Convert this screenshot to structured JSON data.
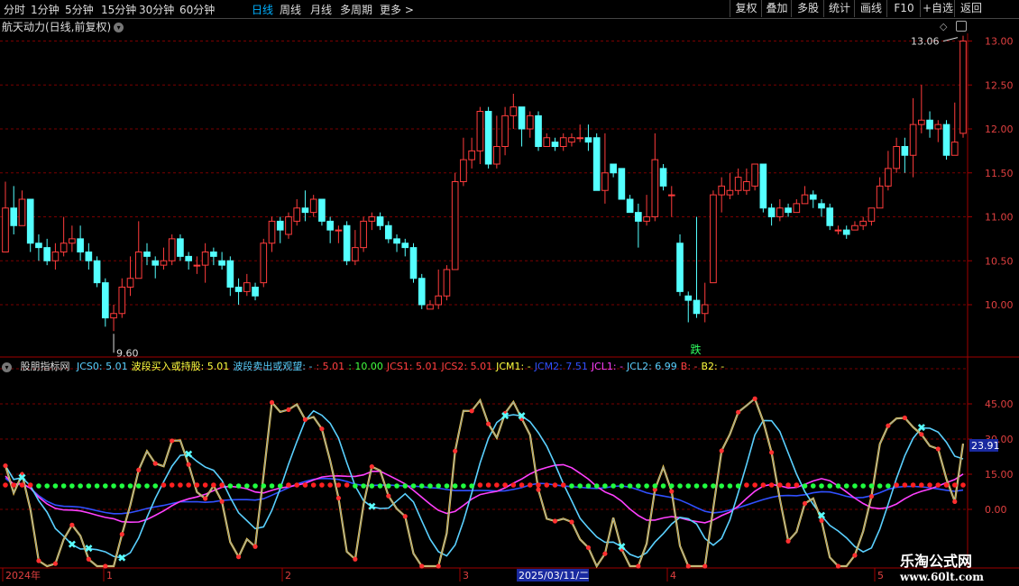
{
  "toolbar": {
    "periods": [
      "分时",
      "1分钟",
      "5分钟",
      "15分钟",
      "30分钟",
      "60分钟",
      "日线",
      "周线",
      "月线",
      "多周期",
      "更多 >"
    ],
    "active_period": "日线",
    "right": [
      "复权",
      "叠加",
      "多股",
      "统计",
      "画线",
      "F10",
      "+自选",
      "返回"
    ]
  },
  "main": {
    "title": "航天动力(日线,前复权)",
    "price_ticks": [
      "13.00",
      "12.50",
      "12.00",
      "11.50",
      "11.00",
      "10.50",
      "10.00"
    ],
    "high_label": "13.06",
    "low_label": "9.60",
    "signal": "跌"
  },
  "indicator": {
    "name": "股朋指标网",
    "legend": [
      {
        "text": "JCS0: 5.01",
        "color": "#5ad0ff"
      },
      {
        "text": "波段买入或持股: 5.01",
        "color": "#ffff40"
      },
      {
        "text": "波段卖出或观望: -",
        "color": "#5ad0ff"
      },
      {
        "text": ": 5.01",
        "color": "#ff4040"
      },
      {
        "text": ": 10.00",
        "color": "#40ff40"
      },
      {
        "text": "JCS1: 5.01",
        "color": "#ff4040"
      },
      {
        "text": "JCS2: 5.01",
        "color": "#ff4040"
      },
      {
        "text": "JCM1: -",
        "color": "#ffff40"
      },
      {
        "text": "JCM2: 7.51",
        "color": "#3050ff"
      },
      {
        "text": "JCL1: -",
        "color": "#ff40ff"
      },
      {
        "text": "JCL2: 6.99",
        "color": "#5ad0ff"
      },
      {
        "text": "B: -",
        "color": "#ff4040"
      },
      {
        "text": "B2: -",
        "color": "#ffff40"
      }
    ],
    "ticks": [
      "45.00",
      "30.00",
      "15.00",
      "0.00"
    ],
    "current_value": "23.91"
  },
  "timeline": {
    "labels": [
      "2024年",
      "1",
      "2",
      "3",
      "4",
      "5"
    ],
    "cursor_date": "2025/03/11/二"
  },
  "colors": {
    "up": "#ff3c3c",
    "down": "#54ffff",
    "grid": "#7a0000",
    "axis": "#a00000"
  },
  "watermark": {
    "line1": "乐淘公式网",
    "line2": "www.60lt.com"
  },
  "chart_data": {
    "type": "candlestick",
    "y_range": [
      9.5,
      13.3
    ],
    "candles": [
      [
        10.6,
        11.1,
        11.4,
        10.6
      ],
      [
        11.1,
        10.9,
        11.35,
        10.8
      ],
      [
        10.9,
        11.2,
        11.3,
        10.9
      ],
      [
        11.2,
        10.7,
        11.2,
        10.6
      ],
      [
        10.7,
        10.65,
        10.8,
        10.5
      ],
      [
        10.65,
        10.5,
        10.75,
        10.45
      ],
      [
        10.5,
        10.6,
        10.7,
        10.4
      ],
      [
        10.6,
        10.7,
        11.0,
        10.55
      ],
      [
        10.7,
        10.75,
        10.9,
        10.6
      ],
      [
        10.75,
        10.6,
        10.9,
        10.5
      ],
      [
        10.6,
        10.5,
        10.7,
        10.4
      ],
      [
        10.5,
        10.25,
        10.55,
        10.2
      ],
      [
        10.25,
        9.85,
        10.3,
        9.75
      ],
      [
        9.85,
        9.9,
        10.0,
        9.7
      ],
      [
        9.9,
        10.2,
        10.3,
        9.85
      ],
      [
        10.2,
        10.3,
        10.55,
        10.1
      ],
      [
        10.3,
        10.6,
        10.95,
        10.3
      ],
      [
        10.6,
        10.55,
        10.7,
        10.45
      ],
      [
        10.5,
        10.45,
        10.55,
        10.3
      ],
      [
        10.45,
        10.5,
        10.65,
        10.4
      ],
      [
        10.5,
        10.75,
        10.8,
        10.45
      ],
      [
        10.75,
        10.55,
        10.8,
        10.5
      ],
      [
        10.55,
        10.5,
        10.6,
        10.4
      ],
      [
        10.45,
        10.45,
        10.55,
        10.35
      ],
      [
        10.45,
        10.6,
        10.7,
        10.25
      ],
      [
        10.6,
        10.55,
        10.65,
        10.45
      ],
      [
        10.5,
        10.45,
        10.6,
        10.4
      ],
      [
        10.5,
        10.2,
        10.55,
        10.1
      ],
      [
        10.2,
        10.15,
        10.3,
        10.0
      ],
      [
        10.15,
        10.25,
        10.35,
        10.1
      ],
      [
        10.2,
        10.1,
        10.25,
        10.05
      ],
      [
        10.25,
        10.7,
        10.75,
        10.2
      ],
      [
        10.7,
        10.95,
        11.0,
        10.6
      ],
      [
        10.95,
        10.85,
        11.0,
        10.7
      ],
      [
        10.8,
        11.0,
        11.05,
        10.75
      ],
      [
        10.95,
        11.1,
        11.2,
        10.9
      ],
      [
        11.1,
        11.05,
        11.3,
        10.95
      ],
      [
        11.05,
        11.2,
        11.25,
        11.0
      ],
      [
        11.2,
        10.95,
        11.2,
        10.9
      ],
      [
        10.95,
        10.85,
        11.0,
        10.7
      ],
      [
        10.85,
        10.85,
        10.9,
        10.7
      ],
      [
        10.9,
        10.5,
        10.95,
        10.45
      ],
      [
        10.5,
        10.65,
        10.85,
        10.45
      ],
      [
        10.65,
        10.95,
        11.0,
        10.6
      ],
      [
        10.95,
        11.0,
        11.05,
        10.85
      ],
      [
        11.0,
        10.9,
        11.05,
        10.85
      ],
      [
        10.9,
        10.75,
        10.95,
        10.7
      ],
      [
        10.75,
        10.7,
        10.8,
        10.6
      ],
      [
        10.7,
        10.65,
        10.75,
        10.55
      ],
      [
        10.65,
        10.3,
        10.7,
        10.25
      ],
      [
        10.3,
        10.0,
        10.35,
        9.95
      ],
      [
        9.95,
        10.0,
        10.05,
        9.95
      ],
      [
        10.0,
        10.1,
        10.4,
        9.95
      ],
      [
        10.1,
        10.4,
        10.45,
        10.05
      ],
      [
        10.4,
        11.4,
        11.5,
        10.4
      ],
      [
        11.4,
        11.65,
        11.9,
        11.35
      ],
      [
        11.65,
        11.75,
        11.9,
        11.55
      ],
      [
        11.75,
        12.2,
        12.25,
        11.6
      ],
      [
        12.2,
        11.6,
        12.25,
        11.55
      ],
      [
        11.6,
        11.8,
        12.15,
        11.55
      ],
      [
        11.8,
        12.15,
        12.25,
        11.7
      ],
      [
        12.15,
        12.25,
        12.4,
        12.0
      ],
      [
        12.25,
        12.0,
        12.25,
        11.8
      ],
      [
        12.0,
        12.15,
        12.2,
        11.9
      ],
      [
        12.15,
        11.8,
        12.2,
        11.75
      ],
      [
        11.8,
        11.9,
        11.95,
        11.8
      ],
      [
        11.85,
        11.8,
        11.9,
        11.75
      ],
      [
        11.8,
        11.9,
        11.95,
        11.75
      ],
      [
        11.85,
        11.9,
        11.95,
        11.8
      ],
      [
        11.9,
        11.9,
        12.05,
        11.85
      ],
      [
        11.9,
        11.85,
        12.05,
        11.75
      ],
      [
        11.9,
        11.3,
        11.95,
        11.3
      ],
      [
        11.3,
        11.5,
        11.95,
        11.15
      ],
      [
        11.6,
        11.5,
        11.6,
        11.45
      ],
      [
        11.55,
        11.2,
        11.55,
        11.2
      ],
      [
        11.2,
        11.05,
        11.25,
        11.05
      ],
      [
        11.05,
        10.95,
        11.15,
        10.65
      ],
      [
        10.95,
        11.0,
        11.25,
        10.9
      ],
      [
        11.0,
        11.65,
        11.95,
        10.95
      ],
      [
        11.55,
        11.35,
        11.6,
        11.3
      ],
      [
        11.25,
        11.25,
        11.35,
        11.0
      ],
      [
        10.7,
        10.15,
        10.8,
        10.1
      ],
      [
        10.1,
        10.05,
        10.15,
        9.8
      ],
      [
        10.05,
        9.9,
        11.0,
        9.85
      ],
      [
        9.9,
        10.0,
        10.25,
        9.8
      ],
      [
        10.25,
        11.25,
        11.3,
        10.95
      ],
      [
        11.25,
        11.35,
        11.45,
        11.05
      ],
      [
        11.25,
        11.3,
        11.5,
        11.2
      ],
      [
        11.3,
        11.45,
        11.55,
        11.25
      ],
      [
        11.3,
        11.4,
        11.55,
        11.25
      ],
      [
        11.35,
        11.6,
        11.6,
        11.3
      ],
      [
        11.6,
        11.1,
        11.6,
        11.05
      ],
      [
        11.1,
        11.0,
        11.15,
        10.9
      ],
      [
        11.0,
        11.1,
        11.2,
        10.95
      ],
      [
        11.1,
        11.05,
        11.15,
        11.0
      ],
      [
        11.05,
        11.15,
        11.2,
        11.05
      ],
      [
        11.15,
        11.25,
        11.35,
        11.15
      ],
      [
        11.25,
        11.2,
        11.3,
        11.1
      ],
      [
        11.15,
        11.1,
        11.2,
        11.0
      ],
      [
        11.1,
        10.9,
        11.15,
        10.85
      ],
      [
        10.85,
        10.85,
        10.9,
        10.8
      ],
      [
        10.85,
        10.8,
        10.9,
        10.75
      ],
      [
        10.85,
        10.9,
        10.95,
        10.85
      ],
      [
        10.9,
        10.95,
        11.0,
        10.85
      ],
      [
        10.95,
        11.1,
        11.1,
        10.9
      ],
      [
        11.1,
        11.35,
        11.45,
        11.1
      ],
      [
        11.35,
        11.55,
        11.75,
        11.3
      ],
      [
        11.55,
        11.8,
        11.9,
        11.5
      ],
      [
        11.8,
        11.7,
        11.9,
        11.5
      ],
      [
        11.7,
        12.05,
        12.35,
        11.45
      ],
      [
        12.05,
        12.1,
        12.5,
        11.95
      ],
      [
        12.1,
        12.0,
        12.2,
        11.9
      ],
      [
        12.0,
        12.05,
        12.1,
        11.85
      ],
      [
        12.05,
        11.7,
        12.1,
        11.65
      ],
      [
        11.7,
        11.85,
        12.3,
        11.7
      ],
      [
        11.95,
        13.0,
        13.06,
        11.9
      ]
    ]
  }
}
